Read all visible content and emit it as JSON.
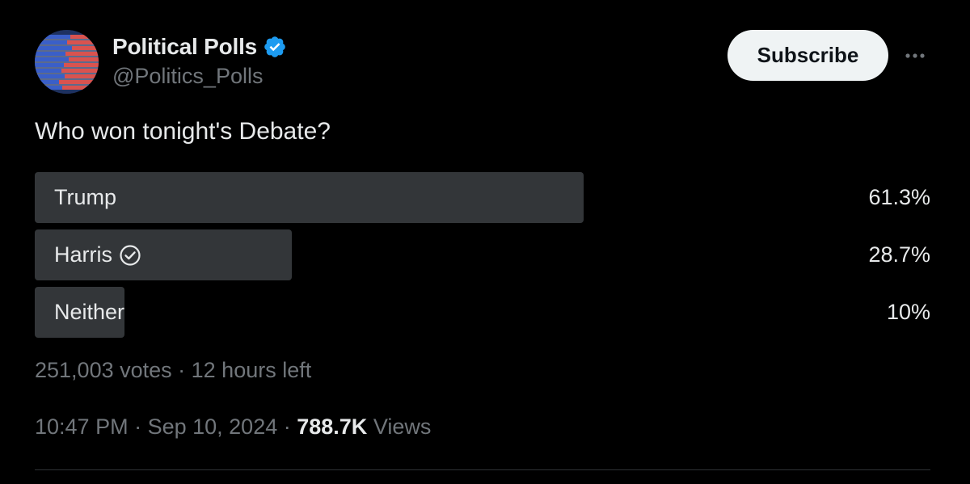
{
  "author": {
    "display_name": "Political Polls",
    "handle": "@Politics_Polls",
    "verified_icon": "verified-badge-icon",
    "verified_color": "#1d9bf0"
  },
  "actions": {
    "subscribe_label": "Subscribe",
    "more_icon": "more-horizontal-icon"
  },
  "post": {
    "text": "Who won tonight's Debate?"
  },
  "poll": {
    "options": [
      {
        "label": "Trump",
        "percent_text": "61.3%",
        "share": 0.613,
        "winner": false
      },
      {
        "label": "Harris",
        "percent_text": "28.7%",
        "share": 0.287,
        "winner": true
      },
      {
        "label": "Neither",
        "percent_text": "10%",
        "share": 0.1,
        "winner": false
      }
    ],
    "votes": "251,003 votes",
    "separator": " · ",
    "time_left": "12 hours left"
  },
  "meta": {
    "time": "10:47 PM",
    "separator": " · ",
    "date": "Sep 10, 2024",
    "views_count": "788.7K",
    "views_label": " Views"
  },
  "colors": {
    "background": "#000000",
    "text_primary": "#e7e9ea",
    "text_secondary": "#71767b",
    "poll_bar": "#333639",
    "subscribe_bg": "#eff3f4"
  }
}
